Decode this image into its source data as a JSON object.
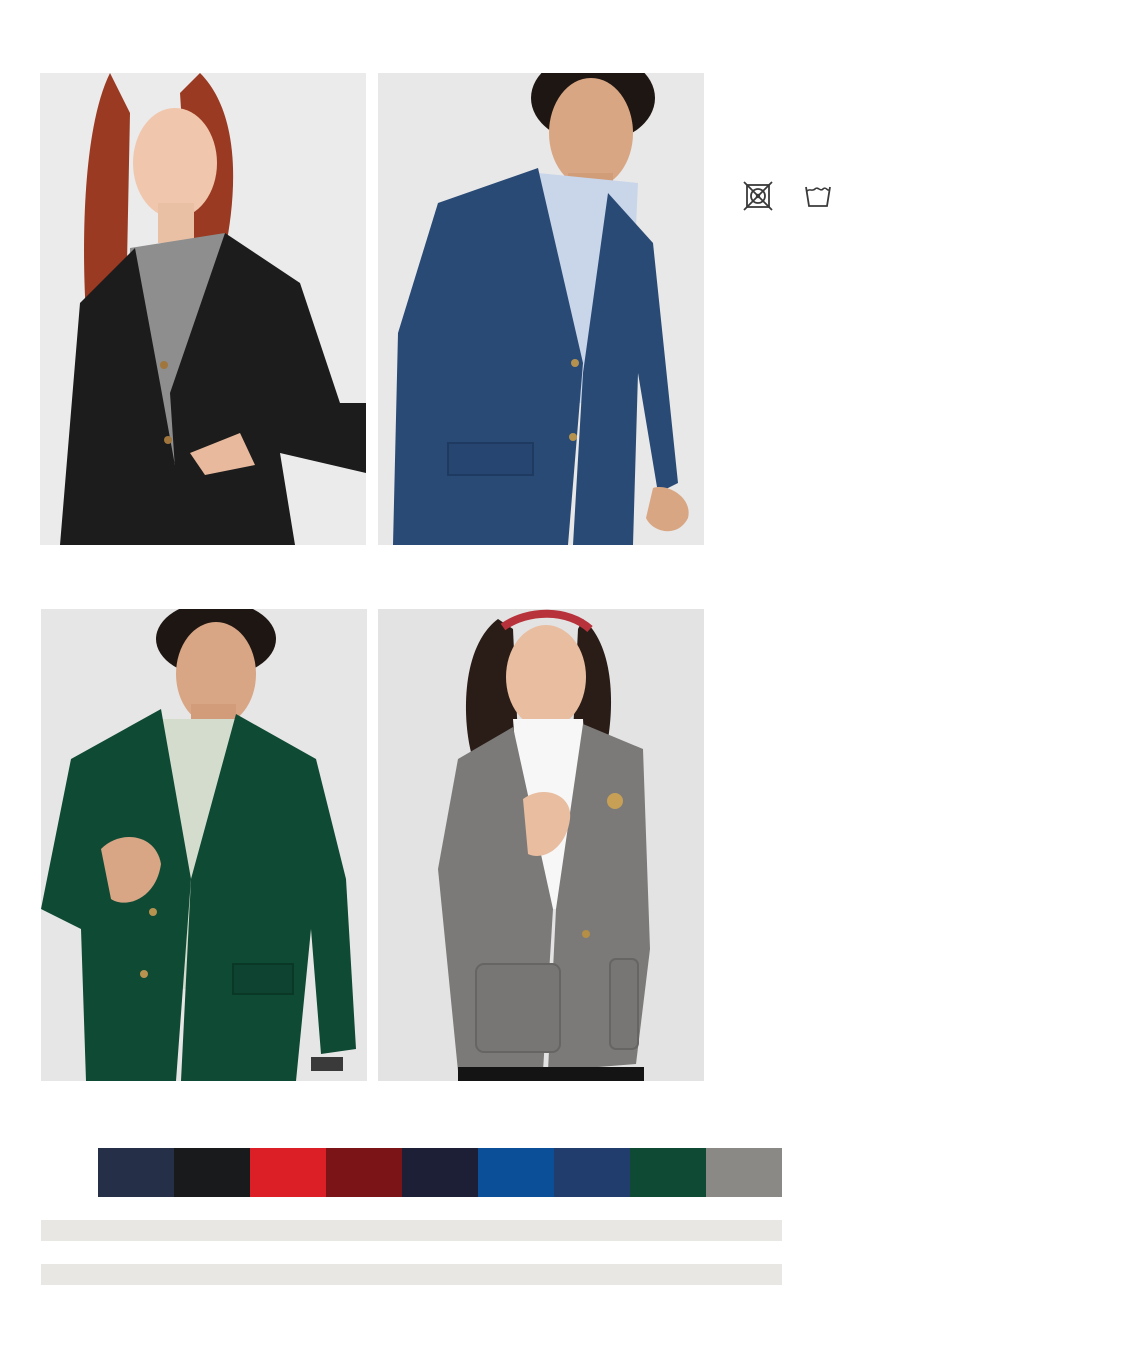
{
  "photos": [
    {
      "id": "photo-1",
      "subject": "woman-black-blazer",
      "jacket_color": "#1c1c1c",
      "shirt_color": "#8e8e8e",
      "hair_color": "#9a3a22"
    },
    {
      "id": "photo-2",
      "subject": "man-navy-blazer",
      "jacket_color": "#2a4a76",
      "shirt_color": "#c9d6ea",
      "hair_color": "#1e1612"
    },
    {
      "id": "photo-3",
      "subject": "man-green-blazer",
      "jacket_color": "#0f4a34",
      "shirt_color": "#d3dccd",
      "hair_color": "#1e1612"
    },
    {
      "id": "photo-4",
      "subject": "woman-grey-blazer",
      "jacket_color": "#7b7a78",
      "shirt_color": "#f7f7f7",
      "hair_color": "#2a1c16"
    }
  ],
  "care_icons": [
    {
      "name": "do-not-tumble-dry-icon"
    },
    {
      "name": "hand-wash-icon"
    }
  ],
  "swatches": [
    {
      "name": "navy",
      "color": "#252f47"
    },
    {
      "name": "black",
      "color": "#191a1c"
    },
    {
      "name": "red",
      "color": "#dc1f26"
    },
    {
      "name": "burgundy",
      "color": "#7a1417"
    },
    {
      "name": "dark-navy",
      "color": "#1d1f37"
    },
    {
      "name": "royal-blue",
      "color": "#0a4f97"
    },
    {
      "name": "steel-navy",
      "color": "#213d6e"
    },
    {
      "name": "forest-green",
      "color": "#0f4a34"
    },
    {
      "name": "grey-heather",
      "color": "#8b8985"
    }
  ]
}
